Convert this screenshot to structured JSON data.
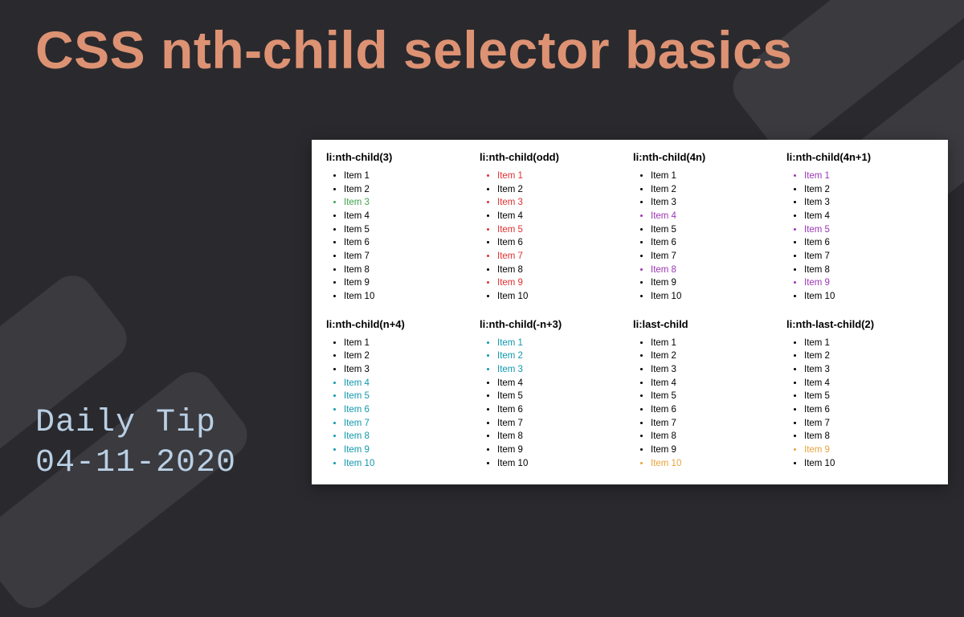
{
  "title": "CSS nth-child selector basics",
  "footer_line1": "Daily Tip",
  "footer_line2": "04-11-2020",
  "item_labels": [
    "Item 1",
    "Item 2",
    "Item 3",
    "Item 4",
    "Item 5",
    "Item 6",
    "Item 7",
    "Item 8",
    "Item 9",
    "Item 10"
  ],
  "columns": [
    {
      "heading": "li:nth-child(3)",
      "highlight_color": "#3fa34d",
      "highlight_indices": [
        3
      ]
    },
    {
      "heading": "li:nth-child(odd)",
      "highlight_color": "#e03131",
      "highlight_indices": [
        1,
        3,
        5,
        7,
        9
      ]
    },
    {
      "heading": "li:nth-child(4n)",
      "highlight_color": "#9c36b5",
      "highlight_indices": [
        4,
        8
      ]
    },
    {
      "heading": "li:nth-child(4n+1)",
      "highlight_color": "#9c36b5",
      "highlight_indices": [
        1,
        5,
        9
      ]
    },
    {
      "heading": "li:nth-child(n+4)",
      "highlight_color": "#1098ad",
      "highlight_indices": [
        4,
        5,
        6,
        7,
        8,
        9,
        10
      ]
    },
    {
      "heading": "li:nth-child(-n+3)",
      "highlight_color": "#1098ad",
      "highlight_indices": [
        1,
        2,
        3
      ]
    },
    {
      "heading": "li:last-child",
      "highlight_color": "#e8a33d",
      "highlight_indices": [
        10
      ]
    },
    {
      "heading": "li:nth-last-child(2)",
      "highlight_color": "#e8a33d",
      "highlight_indices": [
        9
      ]
    }
  ]
}
